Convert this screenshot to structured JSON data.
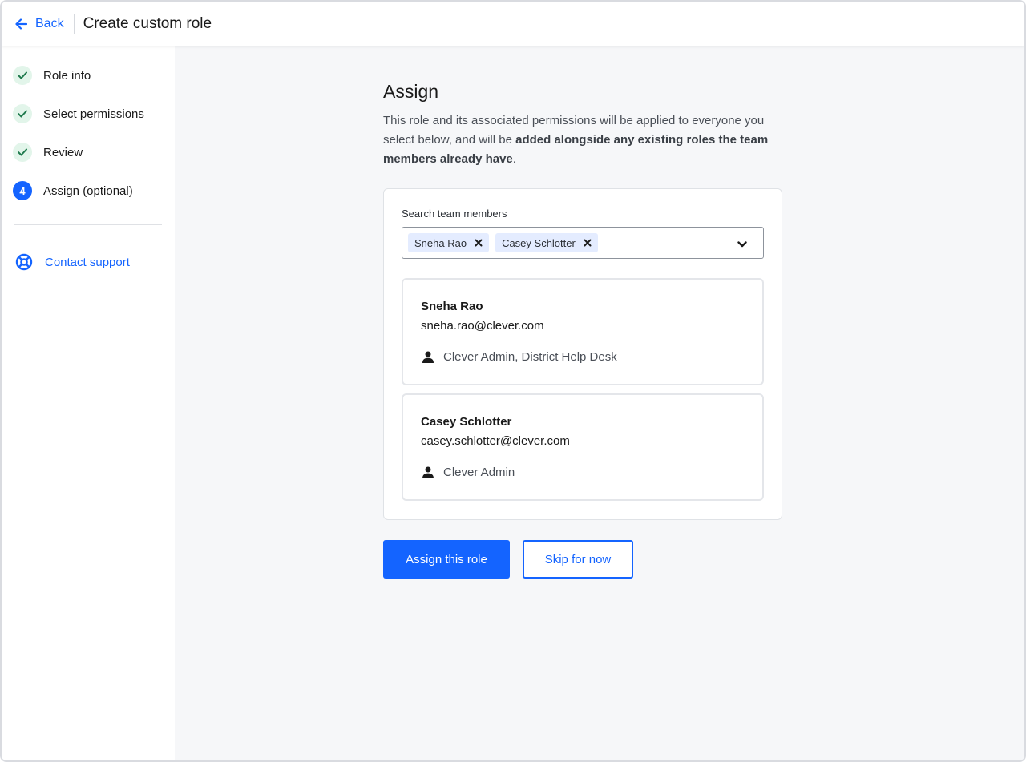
{
  "header": {
    "back_label": "Back",
    "title": "Create custom role"
  },
  "sidebar": {
    "steps": [
      {
        "label": "Role info",
        "status": "complete",
        "icon": "check-icon"
      },
      {
        "label": "Select permissions",
        "status": "complete",
        "icon": "check-icon"
      },
      {
        "label": "Review",
        "status": "complete",
        "icon": "check-icon"
      },
      {
        "label": "Assign (optional)",
        "status": "current",
        "number": "4"
      }
    ],
    "support_label": "Contact support",
    "support_icon": "lifebuoy-icon"
  },
  "main": {
    "heading": "Assign",
    "description_plain": "This role and its associated permissions will be applied to everyone you select below, and will be ",
    "description_bold": "added alongside any existing roles the team members already have",
    "description_end": ".",
    "search": {
      "label": "Search team members",
      "chips": [
        "Sneha Rao",
        "Casey Schlotter"
      ]
    },
    "members": [
      {
        "name": "Sneha Rao",
        "email": "sneha.rao@clever.com",
        "roles": "Clever Admin, District Help Desk"
      },
      {
        "name": "Casey Schlotter",
        "email": "casey.schlotter@clever.com",
        "roles": "Clever Admin"
      }
    ],
    "primary_button": "Assign this role",
    "secondary_button": "Skip for now"
  },
  "colors": {
    "accent": "#1464ff",
    "complete_bg": "#e2f5ea",
    "complete_check": "#1f7a4d",
    "chip_bg": "#e4ecff",
    "main_bg": "#f6f7f9"
  }
}
